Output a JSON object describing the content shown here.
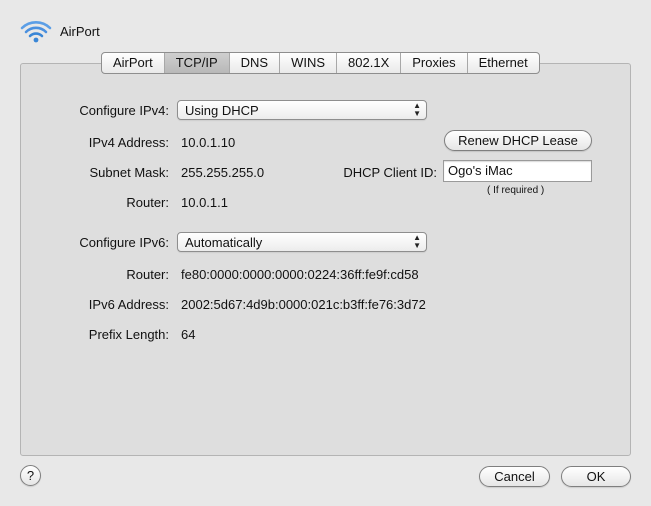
{
  "window": {
    "title": "AirPort"
  },
  "tabs": [
    {
      "label": "AirPort"
    },
    {
      "label": "TCP/IP",
      "active": true
    },
    {
      "label": "DNS"
    },
    {
      "label": "WINS"
    },
    {
      "label": "802.1X"
    },
    {
      "label": "Proxies"
    },
    {
      "label": "Ethernet"
    }
  ],
  "ipv4": {
    "configure_label": "Configure IPv4:",
    "configure_value": "Using DHCP",
    "address_label": "IPv4 Address:",
    "address_value": "10.0.1.10",
    "subnet_label": "Subnet Mask:",
    "subnet_value": "255.255.255.0",
    "router_label": "Router:",
    "router_value": "10.0.1.1",
    "renew_button": "Renew DHCP Lease",
    "client_id_label": "DHCP Client ID:",
    "client_id_value": "Ogo's iMac",
    "client_id_hint": "( If required )"
  },
  "ipv6": {
    "configure_label": "Configure IPv6:",
    "configure_value": "Automatically",
    "router_label": "Router:",
    "router_value": "fe80:0000:0000:0000:0224:36ff:fe9f:cd58",
    "address_label": "IPv6 Address:",
    "address_value": "2002:5d67:4d9b:0000:021c:b3ff:fe76:3d72",
    "prefix_label": "Prefix Length:",
    "prefix_value": "64"
  },
  "footer": {
    "help_label": "?",
    "cancel_label": "Cancel",
    "ok_label": "OK"
  },
  "colors": {
    "background": "#e8e8e8",
    "panel": "#dedede",
    "wifi_icon": "#3a86d6"
  },
  "icons": {
    "wifi": "wifi-icon",
    "popup_arrows": "updown-arrows-icon"
  }
}
